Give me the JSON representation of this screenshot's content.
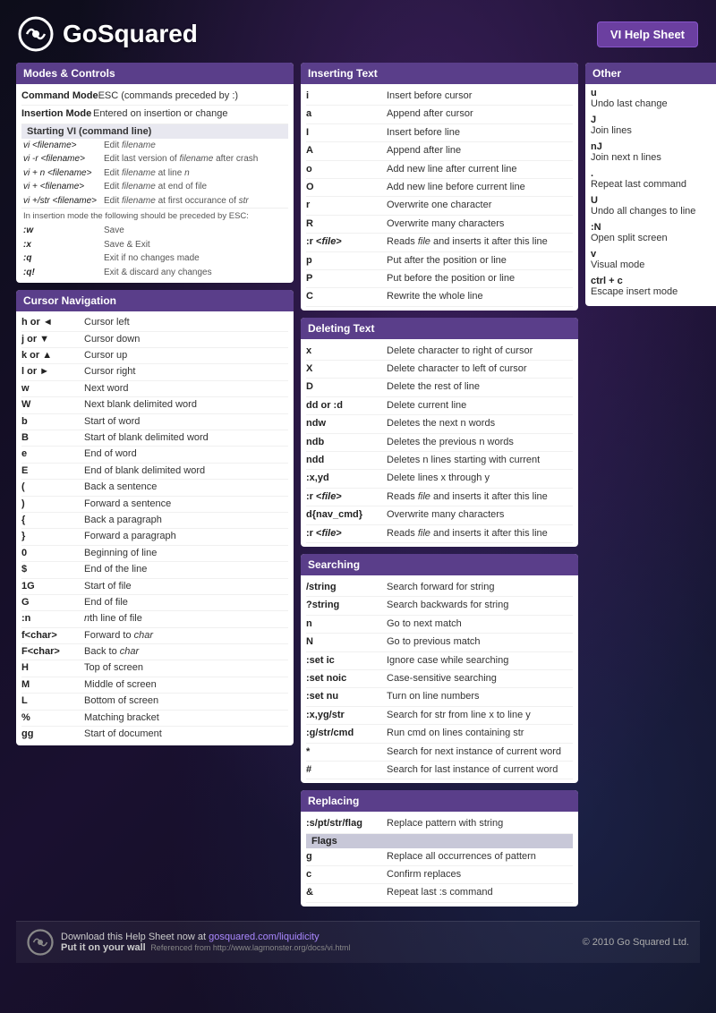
{
  "header": {
    "logo_text": "GoSquared",
    "badge_text": "VI Help Sheet"
  },
  "footer": {
    "download_text": "Download this Help Sheet now at",
    "link_text": "gosquared.com/liquidicity",
    "put_text": "Put it on your wall",
    "ref_text": "Referenced from http://www.lagmonster.org/docs/vi.html",
    "copyright": "© 2010 Go Squared Ltd."
  },
  "modes_controls": {
    "header": "Modes & Controls",
    "modes": [
      {
        "key": "Command Mode",
        "desc": "ESC (commands preceded by :)"
      },
      {
        "key": "Insertion Mode",
        "desc": "Entered on insertion or change"
      }
    ],
    "starting_header": "Starting VI (command line)",
    "vi_commands": [
      {
        "key": "vi <filename>",
        "desc": "Edit filename"
      },
      {
        "key": "vi -r <filename>",
        "desc": "Edit last version of filename after crash"
      },
      {
        "key": "vi + n <filename>",
        "desc": "Edit filename at line n"
      },
      {
        "key": "vi + <filename>",
        "desc": "Edit filename at end of file"
      },
      {
        "key": "vi +/str <filename>",
        "desc": "Edit filename at first occurance of str"
      }
    ],
    "insertion_note": "In insertion mode the following should be preceded by ESC:",
    "save_commands": [
      {
        "key": ":w",
        "desc": "Save"
      },
      {
        "key": ":x",
        "desc": "Save & Exit"
      },
      {
        "key": ":q",
        "desc": "Exit if no changes made"
      },
      {
        "key": ":q!",
        "desc": "Exit & discard any changes"
      }
    ]
  },
  "cursor_nav": {
    "header": "Cursor Navigation",
    "commands": [
      {
        "key": "h or ◄",
        "desc": "Cursor left"
      },
      {
        "key": "j or ▼",
        "desc": "Cursor down"
      },
      {
        "key": "k or ▲",
        "desc": "Cursor up"
      },
      {
        "key": "l or ►",
        "desc": "Cursor right"
      },
      {
        "key": "w",
        "desc": "Next word"
      },
      {
        "key": "W",
        "desc": "Next blank delimited word"
      },
      {
        "key": "b",
        "desc": "Start of word"
      },
      {
        "key": "B",
        "desc": "Start of blank delimited word"
      },
      {
        "key": "e",
        "desc": "End of word"
      },
      {
        "key": "E",
        "desc": "End of blank delimited word"
      },
      {
        "key": "(",
        "desc": "Back a sentence"
      },
      {
        "key": ")",
        "desc": "Forward a sentence"
      },
      {
        "key": "{",
        "desc": "Back a paragraph"
      },
      {
        "key": "}",
        "desc": "Forward a paragraph"
      },
      {
        "key": "0",
        "desc": "Beginning of line"
      },
      {
        "key": "$",
        "desc": "End of the line"
      },
      {
        "key": "1G",
        "desc": "Start of file"
      },
      {
        "key": "G",
        "desc": "End of file"
      },
      {
        "key": ":n",
        "desc": "nth line of file"
      },
      {
        "key": "f<char>",
        "desc": "Forward to char"
      },
      {
        "key": "F<char>",
        "desc": "Back to char"
      },
      {
        "key": "H",
        "desc": "Top of screen"
      },
      {
        "key": "M",
        "desc": "Middle of screen"
      },
      {
        "key": "L",
        "desc": "Bottom of screen"
      },
      {
        "key": "%",
        "desc": "Matching bracket"
      },
      {
        "key": "gg",
        "desc": "Start of document"
      }
    ]
  },
  "inserting_text": {
    "header": "Inserting Text",
    "commands": [
      {
        "key": "i",
        "desc": "Insert before cursor"
      },
      {
        "key": "a",
        "desc": "Append after cursor"
      },
      {
        "key": "I",
        "desc": "Insert before line"
      },
      {
        "key": "A",
        "desc": "Append after line"
      },
      {
        "key": "o",
        "desc": "Add new line after current line"
      },
      {
        "key": "O",
        "desc": "Add new line before current line"
      },
      {
        "key": "r",
        "desc": "Overwrite one character"
      },
      {
        "key": "R",
        "desc": "Overwrite many characters"
      },
      {
        "key": ":r <file>",
        "desc": "Reads file and inserts it after this line"
      },
      {
        "key": "p",
        "desc": "Put after the position or line"
      },
      {
        "key": "P",
        "desc": "Put before the position or line"
      },
      {
        "key": "C",
        "desc": "Rewrite the whole line"
      }
    ]
  },
  "deleting_text": {
    "header": "Deleting Text",
    "commands": [
      {
        "key": "x",
        "desc": "Delete character to right of cursor"
      },
      {
        "key": "X",
        "desc": "Delete character to left of cursor"
      },
      {
        "key": "D",
        "desc": "Delete the rest of line"
      },
      {
        "key": "dd or :d",
        "desc": "Delete current line"
      },
      {
        "key": "ndw",
        "desc": "Deletes the next n words"
      },
      {
        "key": "ndb",
        "desc": "Deletes the previous n words"
      },
      {
        "key": "ndd",
        "desc": "Deletes n lines starting with current"
      },
      {
        "key": ":x,yd",
        "desc": "Delete lines x through y"
      },
      {
        "key": ":r <file>",
        "desc": "Reads file and inserts it after this line"
      },
      {
        "key": "d{nav_cmd}",
        "desc": "Overwrite many characters"
      },
      {
        "key": ":r <file>",
        "desc": "Reads file and inserts it after this line"
      }
    ]
  },
  "searching": {
    "header": "Searching",
    "commands": [
      {
        "key": "/string",
        "desc": "Search forward for string"
      },
      {
        "key": "?string",
        "desc": "Search backwards for string"
      },
      {
        "key": "n",
        "desc": "Go to next match"
      },
      {
        "key": "N",
        "desc": "Go to previous match"
      },
      {
        "key": ":set ic",
        "desc": "Ignore case while searching"
      },
      {
        "key": ":set noic",
        "desc": "Case-sensitive searching"
      },
      {
        "key": ":set nu",
        "desc": "Turn on line numbers"
      },
      {
        "key": ":x,yg/str",
        "desc": "Search for str from line x to line y"
      },
      {
        "key": ":g/str/cmd",
        "desc": "Run cmd on lines containing str"
      },
      {
        "key": "*",
        "desc": "Search for next instance of current word"
      },
      {
        "key": "#",
        "desc": "Search for last instance of current word"
      }
    ]
  },
  "replacing": {
    "header": "Replacing",
    "commands": [
      {
        "key": ":s/pt/str/flag",
        "desc": "Replace pattern with string"
      }
    ],
    "flags_header": "Flags",
    "flags": [
      {
        "key": "g",
        "desc": "Replace all occurrences of pattern"
      },
      {
        "key": "c",
        "desc": "Confirm replaces"
      },
      {
        "key": "&",
        "desc": "Repeat last :s command"
      }
    ]
  },
  "other": {
    "header": "Other",
    "commands": [
      {
        "key": "u",
        "desc": "Undo last change"
      },
      {
        "key": "J",
        "desc": "Join lines"
      },
      {
        "key": "nJ",
        "desc": "Join next n lines"
      },
      {
        "key": ".",
        "desc": "Repeat last command"
      },
      {
        "key": "U",
        "desc": "Undo all changes to line"
      },
      {
        "key": ":N",
        "desc": "Open split screen"
      },
      {
        "key": "v",
        "desc": "Visual mode"
      },
      {
        "key": "ctrl + c",
        "desc": "Escape insert mode"
      }
    ]
  }
}
